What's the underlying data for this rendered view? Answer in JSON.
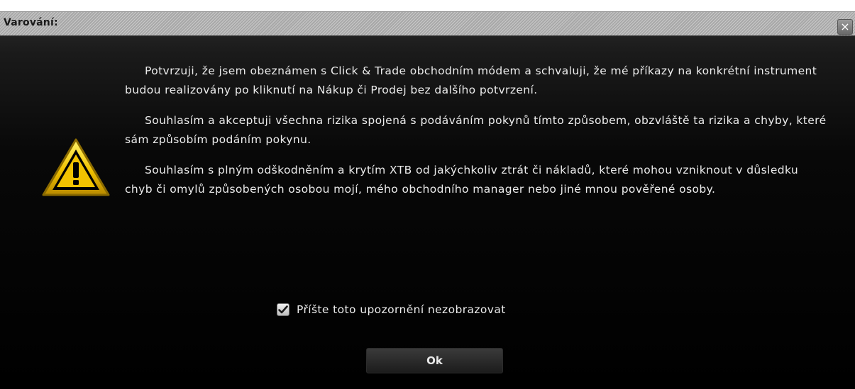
{
  "dialog": {
    "title": "Varování:",
    "close_symbol": "×",
    "icon": "warning-triangle-icon",
    "paragraphs": [
      "Potvrzuji, že jsem obeznámen s Click & Trade obchodním módem a schvaluji, že mé příkazy na konkrétní instrument budou realizovány po kliknutí na Nákup či Prodej bez dalšího potvrzení.",
      "Souhlasím a akceptuji všechna rizika spojená s podáváním pokynů tímto způsobem, obzvláště ta rizika a chyby, které sám způsobím podáním pokynu.",
      "Souhlasím s plným odškodněním a krytím XTB od jakýchkoliv ztrát či nákladů, které mohou vzniknout v důsledku chyb či omylů způsobených osobou mojí, mého obchodního manager nebo jiné mnou pověřené osoby."
    ],
    "checkbox": {
      "label": "Příšte toto upozornění nezobrazovat",
      "checked": true
    },
    "ok_label": "Ok"
  },
  "colors": {
    "background": "#000000",
    "text": "#ececec",
    "warning_yellow": "#f2c200"
  }
}
